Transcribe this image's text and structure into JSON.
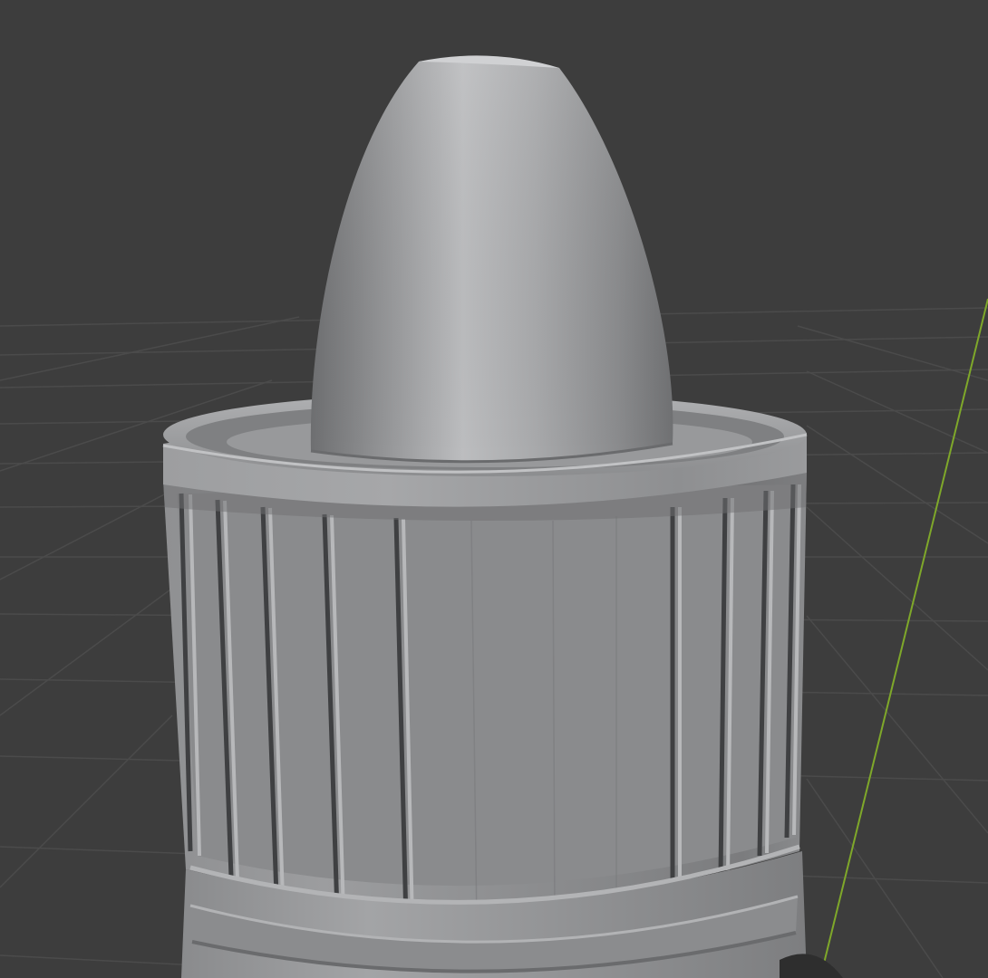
{
  "viewport": {
    "background_color": "#3d3d3d",
    "grid_line_color": "#4a4a4a",
    "y_axis_color": "#7fa82a"
  },
  "model": {
    "object": "bottle-cap-with-dropper-tip",
    "material_color": "#8e8f91",
    "highlight_color": "#c4c5c7",
    "shadow_color": "#5f6062"
  }
}
